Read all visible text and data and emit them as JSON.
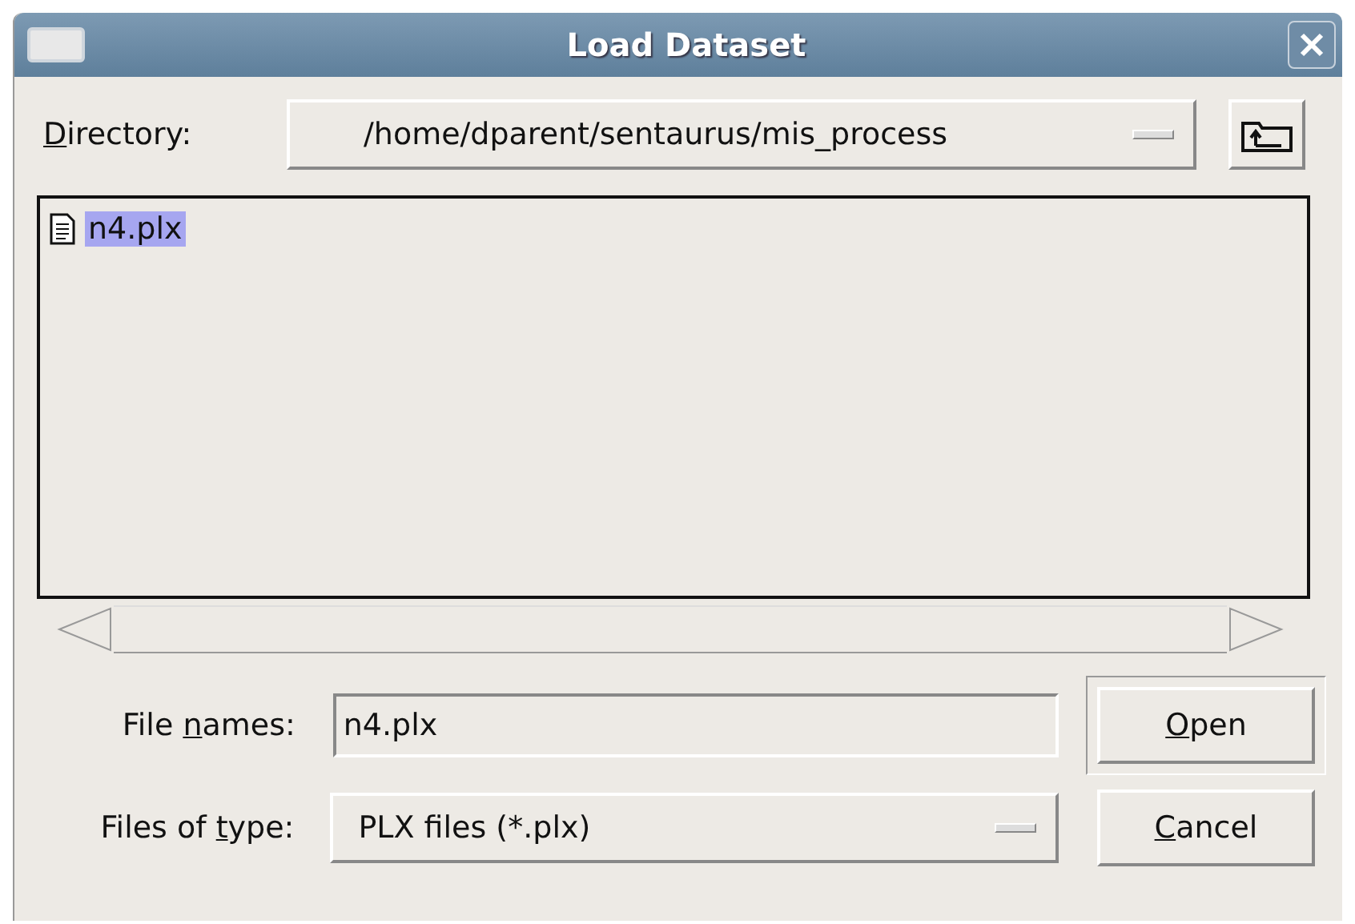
{
  "window": {
    "title": "Load Dataset"
  },
  "directory": {
    "label": {
      "key": "D",
      "after": "irectory:"
    },
    "value": "/home/dparent/sentaurus/mis_process"
  },
  "files": [
    {
      "name": "n4.plx",
      "selected": true
    }
  ],
  "file_name": {
    "label": {
      "before": "File ",
      "key": "n",
      "after": "ames:"
    },
    "value": "n4.plx"
  },
  "file_type": {
    "label": {
      "before": "Files of ",
      "key": "t",
      "after": "ype:"
    },
    "value": "PLX files (*.plx)"
  },
  "buttons": [
    {
      "label": {
        "key": "O",
        "after": "pen"
      },
      "default": true
    },
    {
      "label": {
        "key": "C",
        "after": "ancel"
      },
      "default": false
    }
  ]
}
